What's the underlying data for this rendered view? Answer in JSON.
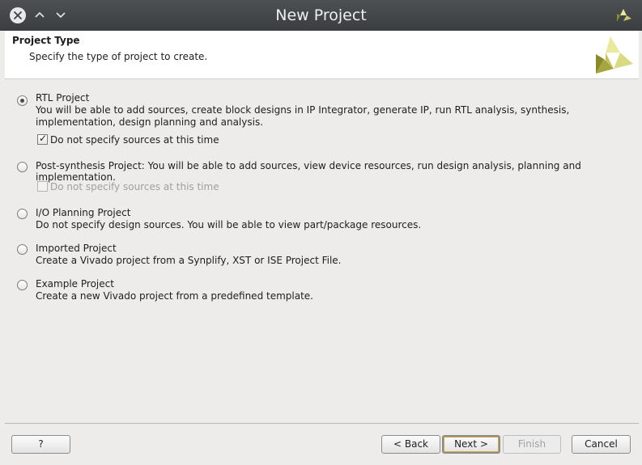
{
  "window": {
    "title": "New Project"
  },
  "header": {
    "title": "Project Type",
    "subtitle": "Specify the type of project to create."
  },
  "options": [
    {
      "title": "RTL Project",
      "description": "You will be able to add sources, create block designs in IP Integrator, generate IP, run RTL analysis, synthesis, implementation, design planning and analysis.",
      "selected": true,
      "checkbox": {
        "label": "Do not specify sources at this time",
        "checked": true,
        "enabled": true
      }
    },
    {
      "title": "Post-synthesis Project: You will be able to add sources, view device resources, run design analysis, planning and implementation.",
      "description": "",
      "selected": false,
      "checkbox": {
        "label": "Do not specify sources at this time",
        "checked": false,
        "enabled": false
      }
    },
    {
      "title": "I/O Planning Project",
      "description": "Do not specify design sources. You will be able to view part/package resources.",
      "selected": false
    },
    {
      "title": "Imported Project",
      "description": "Create a Vivado project from a Synplify, XST or ISE Project File.",
      "selected": false
    },
    {
      "title": "Example Project",
      "description": "Create a new Vivado project from a predefined template.",
      "selected": false
    }
  ],
  "buttons": {
    "help": "?",
    "back": "< Back",
    "next": "Next >",
    "finish": "Finish",
    "cancel": "Cancel"
  },
  "icons": {
    "close": "close-icon",
    "minimize": "chevron-up-icon",
    "maximize": "chevron-down-icon",
    "logo": "vivado-logo-icon"
  },
  "colors": {
    "titlebar": "#3f4244",
    "logo_light": "#e7e89a",
    "logo_dark": "#8c8b2d"
  }
}
